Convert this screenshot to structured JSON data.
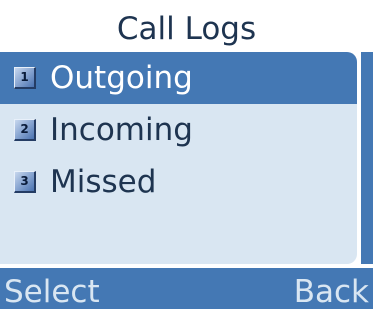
{
  "screen": {
    "title": "Call Logs"
  },
  "menu": {
    "selected_index": 0,
    "items": [
      {
        "number": "1",
        "label": "Outgoing"
      },
      {
        "number": "2",
        "label": "Incoming"
      },
      {
        "number": "3",
        "label": "Missed"
      }
    ]
  },
  "softkeys": {
    "left_label": "Select",
    "right_label": "Back"
  },
  "colors": {
    "accent": "#4478b4",
    "panel_background": "#d9e6f2",
    "text": "#1e3450",
    "selected_text": "#ffffff"
  }
}
